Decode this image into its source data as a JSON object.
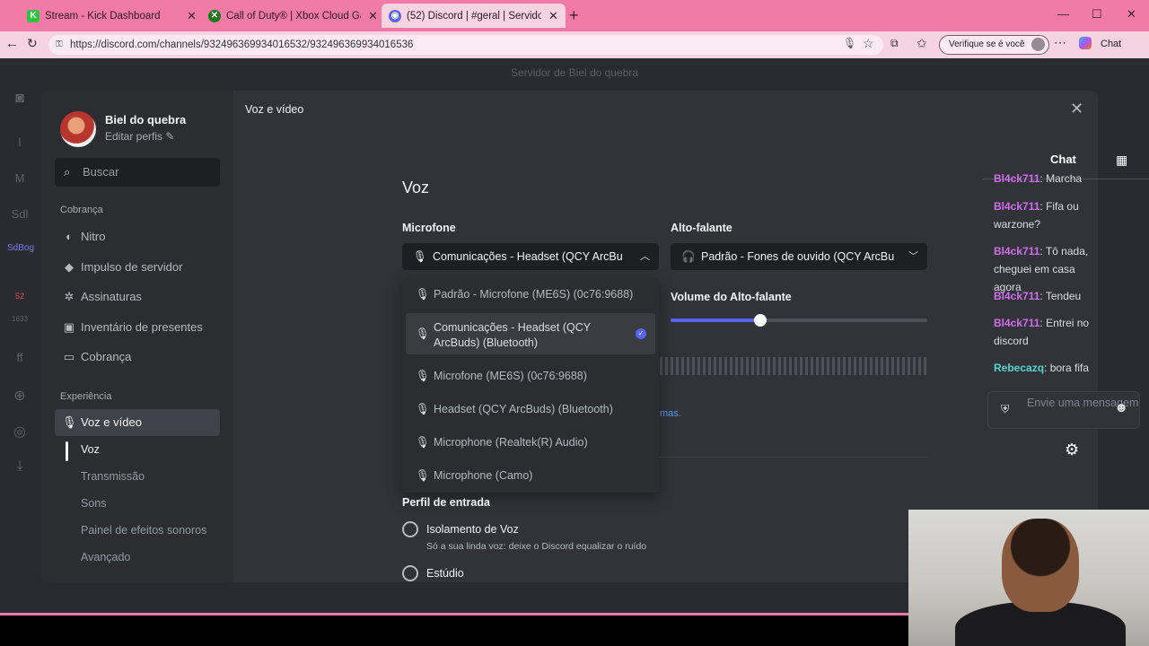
{
  "browser": {
    "tabs": [
      {
        "title": "Stream - Kick Dashboard",
        "icon": "kick-icon",
        "color": "#2dc53e"
      },
      {
        "title": "Call of Duty® | Xbox Cloud Gaming",
        "icon": "xbox-icon",
        "color": "#1f7a1f"
      },
      {
        "title": "(52) Discord | #geral | Servidor",
        "icon": "discord-icon",
        "color": "#5865f2"
      }
    ],
    "url": "https://discord.com/channels/932496369934016532/932496369934016536",
    "verify_label": "Verifique se é você",
    "chat_label": "Chat"
  },
  "discord_bg": {
    "server_title": "Servidor de Biel do quebra",
    "rail": [
      "l",
      "M",
      "Sdl",
      "SdBog",
      "52",
      "1633",
      "ff"
    ]
  },
  "settings": {
    "user": {
      "name": "Biel do quebra",
      "edit_label": "Editar perfis"
    },
    "search_placeholder": "Buscar",
    "sections": {
      "billing": "Cobrança",
      "experience": "Experiência"
    },
    "billing_items": [
      "Nitro",
      "Impulso de servidor",
      "Assinaturas",
      "Inventário de presentes",
      "Cobrança"
    ],
    "voice_item": "Voz e vídeo",
    "sub_items": [
      "Voz",
      "Transmissão",
      "Sons",
      "Painel de efeitos sonoros",
      "Avançado"
    ],
    "page_label": "Voz e vídeo",
    "voice_title": "Voz",
    "microphone": {
      "label": "Microfone",
      "selected": "Comunicações - Headset (QCY ArcBu",
      "options": [
        "Padrão - Microfone (ME6S) (0c76:9688)",
        "Comunicações - Headset (QCY ArcBuds) (Bluetooth)",
        "Microfone (ME6S) (0c76:9688)",
        "Headset (QCY ArcBuds) (Bluetooth)",
        "Microphone (Realtek(R) Audio)",
        "Microphone (Camo)"
      ],
      "checked_index": 1
    },
    "speaker": {
      "label": "Alto-falante",
      "selected": "Padrão - Fones de ouvido (QCY ArcBu",
      "volume_label": "Volume do Alto-falante",
      "volume_fraction": 0.35
    },
    "link_fragment": "mas.",
    "input_profile": {
      "label": "Perfil de entrada",
      "options": [
        {
          "name": "Isolamento de Voz",
          "desc": "Só a sua linda voz: deixe o Discord equalizar o ruído"
        },
        {
          "name": "Estúdio",
          "desc": ""
        }
      ]
    }
  },
  "stream_chat": {
    "title": "Chat",
    "messages": [
      {
        "user": "Bl4ck711",
        "text": "Marcha",
        "color": "#d16ef0"
      },
      {
        "user": "Bl4ck711",
        "text": "Fifa ou warzone?",
        "color": "#d16ef0"
      },
      {
        "user": "Bl4ck711",
        "text": "Tô nada, cheguei em casa agora",
        "color": "#d16ef0"
      },
      {
        "user": "Bl4ck711",
        "text": "Tendeu",
        "color": "#d16ef0"
      },
      {
        "user": "Bl4ck711",
        "text": "Entrei no discord",
        "color": "#d16ef0"
      },
      {
        "user": "Rebecazq",
        "text": "bora fifa",
        "color": "#53d6d1"
      }
    ],
    "input_placeholder": "Envie uma mensagem"
  }
}
